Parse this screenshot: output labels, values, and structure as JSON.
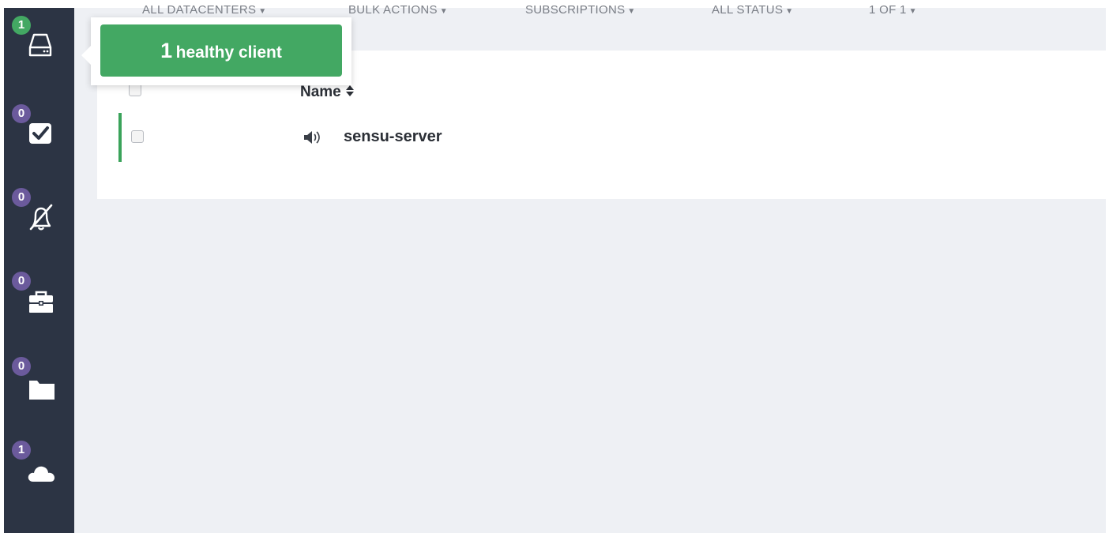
{
  "sidebar": {
    "items": [
      {
        "id": "clients",
        "badge": "1",
        "icon": "server-drive-icon",
        "badge_color": "#43a863"
      },
      {
        "id": "checks",
        "badge": "0",
        "icon": "checkbox-checked-icon",
        "badge_color": "#6b5a9c"
      },
      {
        "id": "silenced",
        "badge": "0",
        "icon": "bell-slash-icon",
        "badge_color": "#6b5a9c"
      },
      {
        "id": "stashes",
        "badge": "0",
        "icon": "briefcase-icon",
        "badge_color": "#6b5a9c"
      },
      {
        "id": "aggregates",
        "badge": "0",
        "icon": "folder-icon",
        "badge_color": "#6b5a9c"
      },
      {
        "id": "datacenters",
        "badge": "1",
        "icon": "cloud-icon",
        "badge_color": "#6b5a9c"
      }
    ]
  },
  "toolbar": {
    "datacenters": "ALL DATACENTERS",
    "bulk_actions": "BULK ACTIONS",
    "subscriptions": "SUBSCRIPTIONS",
    "status": "ALL STATUS",
    "pagination": "1 OF 1"
  },
  "tooltip": {
    "count": "1",
    "text": "healthy client"
  },
  "table": {
    "name_header": "Name",
    "rows": [
      {
        "name": "sensu-server",
        "status_color": "#3aa35a",
        "icon": "speaker-icon"
      }
    ]
  },
  "colors": {
    "sidebar_bg": "#2c3444",
    "healthy": "#43a863",
    "badge_neutral": "#6b5a9c",
    "main_bg": "#eef0f4"
  }
}
